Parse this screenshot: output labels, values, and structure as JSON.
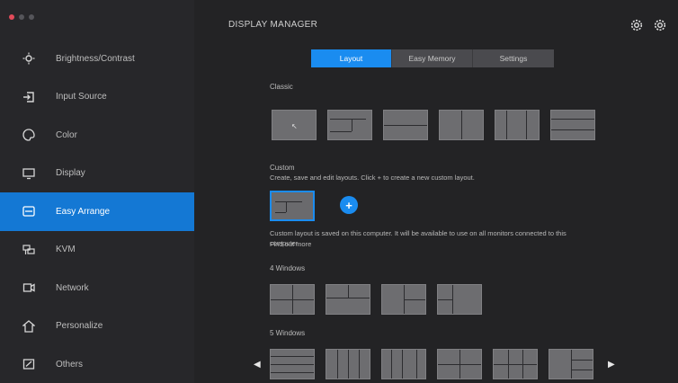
{
  "window": {
    "title": "DISPLAY MANAGER"
  },
  "sidebar": {
    "items": [
      {
        "label": "Brightness/Contrast",
        "icon": "brightness-icon"
      },
      {
        "label": "Input Source",
        "icon": "input-icon"
      },
      {
        "label": "Color",
        "icon": "color-icon"
      },
      {
        "label": "Display",
        "icon": "display-icon"
      },
      {
        "label": "Easy Arrange",
        "icon": "easy-arrange-icon"
      },
      {
        "label": "KVM",
        "icon": "kvm-icon"
      },
      {
        "label": "Network",
        "icon": "network-icon"
      },
      {
        "label": "Personalize",
        "icon": "personalize-icon"
      },
      {
        "label": "Others",
        "icon": "others-icon"
      }
    ],
    "active_index": 4
  },
  "tabs": [
    {
      "label": "Layout"
    },
    {
      "label": "Easy Memory"
    },
    {
      "label": "Settings"
    }
  ],
  "sections": {
    "classic_label": "Classic",
    "custom_label": "Custom",
    "custom_hint": "Create, save and edit layouts. Click + to create a new custom layout.",
    "custom_note": "Custom layout is saved on this computer. It will be available to use on all monitors connected to this computer.",
    "custom_note2": "Find out more",
    "four_window_label": "4 Windows",
    "five_window_label": "5 Windows"
  },
  "colors": {
    "accent": "#1a8cf0",
    "sidebar_active": "#1478d4",
    "background": "#232325",
    "tile": "#6d6d70"
  }
}
